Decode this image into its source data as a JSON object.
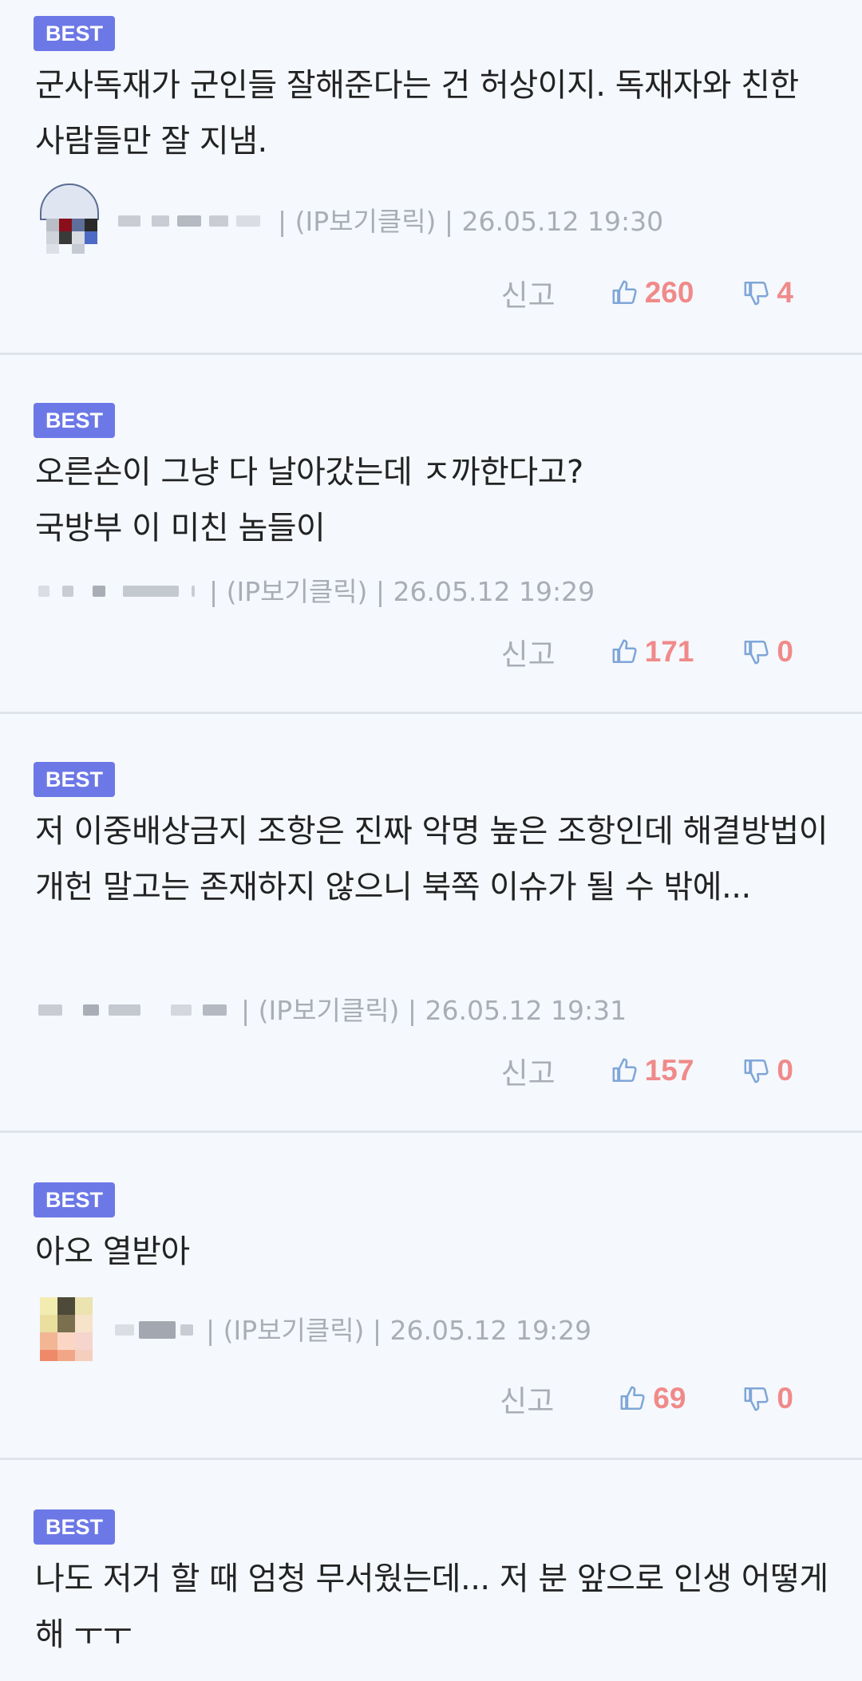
{
  "best_label": "BEST",
  "report_label": "신고",
  "comments": [
    {
      "text": "군사독재가 군인들 잘해준다는 건 허상이지. 독재자와 친한 사람들만 잘 지냄.",
      "meta_text": "| (IP보기클릭) | 26.05.12 19:30",
      "likes": "260",
      "dislikes": "4"
    },
    {
      "text": "오른손이 그냥 다 날아갔는데 ㅈ까한다고?\n국방부 이 미친 놈들이",
      "meta_text": "| (IP보기클릭) | 26.05.12 19:29",
      "likes": "171",
      "dislikes": "0"
    },
    {
      "text": "저 이중배상금지 조항은 진짜 악명 높은 조항인데 해결방법이 개헌 말고는 존재하지 않으니 북쪽 이슈가 될 수 밖에...",
      "meta_text": "| (IP보기클릭) | 26.05.12 19:31",
      "likes": "157",
      "dislikes": "0"
    },
    {
      "text": "아오 열받아",
      "meta_text": "| (IP보기클릭) | 26.05.12 19:29",
      "likes": "69",
      "dislikes": "0"
    },
    {
      "text": "나도 저거 할 때 엄청 무서웠는데... 저 분 앞으로 인생 어떻게 해 ㅜㅜ"
    }
  ],
  "colors": {
    "best_badge": "#6c78e6",
    "like_icon": "#7fa6d8",
    "count": "#f08a8a",
    "muted": "#a8adb6"
  }
}
